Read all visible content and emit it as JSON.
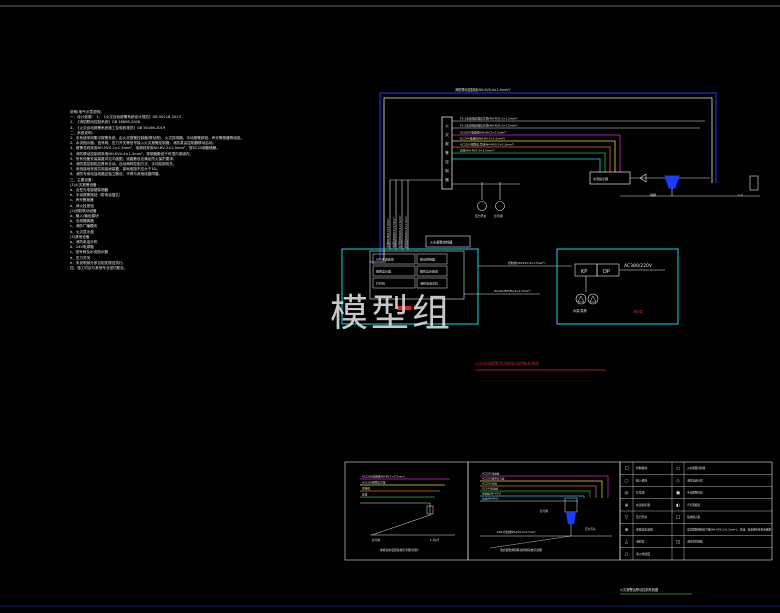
{
  "watermark": "模型组",
  "notes": [
    "说明(电气示意说明)",
    "一、设计依据：  1、《火灾自动报警系统设计规范》GB 50116-2013",
    "  2、《消防联动控制系统》GB 16806-2006",
    "  3、《火灾自动报警系统施工及验收规范》GB 50166-2019",
    "二、系统说明：",
    "1、本系统采用集中报警系统，由火灾报警控制器(联动型)、火灾探测器、手动报警按钮、声光警报器等组成。",
    "2、水流指示器、信号阀、压力开关等信号接入火灾报警控制器，消防泵由控制器联动启动。",
    "3、报警总线采用NH-RVS-2×1.5mm²，电源线采用NH-BV-2×2.5mm²，穿SC20钢管暗敷。",
    "4、消防联动控制线采用NH-KVV-4×1.5mm²，穿钢管敷设于吊顶内或墙内。",
    "5、所有设备安装高度详见平面图，线路敷设应满足防火保护要求。",
    "6、消防泵控制柜应具有手动、自动两种控制方式，手动控制优先。",
    "7、系统接地采用共用接地装置，接地电阻不应大于1Ω。",
    "8、消防专用电话线路应独立敷设，不得与其他线路同管。",
    "三、主要设备：",
    "(1)火灾报警设备",
    "  a、点型光电感烟探测器",
    "  b、手动报警按钮（带电话插孔）",
    "  c、声光警报器",
    "  d、消火栓按钮",
    "(2)消防联动设备",
    "  a、输入/输出模块",
    "  b、总线隔离器",
    "  c、消防广播模块",
    "  d、火灾显示盘",
    "(3)其他设备",
    "  a、消防电话分机",
    "  b、24V电源箱",
    "  c、信号阀及水流指示器",
    "  d、压力开关",
    "  e、未说明部分参见相关规范执行。",
    "四、施工时应与其他专业密切配合。"
  ],
  "main_diagram": {
    "top_bus_label": "消防联动控制线(NH-KVV-4×1.5mm²)",
    "panel_labels": [
      "火",
      "灾",
      "报",
      "警",
      "控",
      "制",
      "器"
    ],
    "signal_lines": [
      "FS-1水流指示器信号线(NH-RVS-2×1.5mm²)",
      "FS-2水流指示器信号线(NH-RVS-2×1.5mm²)",
      "AC220V电源线(NH-BV-2×2.5mm²)",
      "DC24V电源线(NH-BV-2×2.5mm²)",
      "AC220V报警信号线(NH-RVS-2×1.5mm²)",
      "总线(NH-RVS-2×1.5mm²)"
    ],
    "vertical_lines": [
      "总线NH-RVS-2×1.5mm²",
      "电源线NH-BV-2×2.5mm²",
      "信号线NH-RVS-2×1.5mm²",
      "控制线NH-KVV-4×1.5mm²"
    ],
    "middle_line_label": "信号线NH-RVS-2×1.5mm²",
    "controller_title": "火灾报警控制器",
    "controller_cells": [
      "UPS电源装置",
      "联动控制器",
      "报警显示器",
      "图形显示装置",
      "打印机",
      "消防电话总机"
    ],
    "link_label": "控制线(NH-KVV-4×1.5mm²)",
    "dp_label": "DC24V(NH-BV-2×2.5mm²)",
    "pump_box": {
      "kp": "KP",
      "dp": "DP",
      "voltage": "AC380/220V",
      "pump_label": "水泵/泵房"
    },
    "pump_red_label": "消防泵",
    "right_device_label": "水流指示器",
    "bottom_device_1": "压力开关",
    "bottom_device_2": "信号阀",
    "right_label_1": "闸阀",
    "right_label_2": "2.2",
    "caption": "火灾自动报警及消防联动控制系统图"
  },
  "small_diagram_left": {
    "lines": [
      "AC220V电源线(NH-BV-2×2.5mm²)",
      "AC220V报警信号线",
      "控制线",
      "总线"
    ],
    "labels": [
      "信号阀",
      "1-1信号"
    ],
    "caption": "末端试水装置系统示意图(局部)"
  },
  "small_diagram_right": {
    "lines": [
      "AC220V电源线",
      "AC220V报警信号线",
      "AC220V总线",
      "DC24V电源线",
      "控制线(NH-KVV)",
      "总线(NH-RVS)"
    ],
    "bottom_label": "ZD4-控制线NH-KVV-4×1.5mm²",
    "caption": "湿式报警阀组联动控制系统示意图",
    "mid_labels": [
      "信号阀",
      "压力开关"
    ]
  },
  "legend": {
    "rows": [
      {
        "symbol": "☐",
        "name": "控制模块",
        "sym2": "▭",
        "name2": "火灾报警控制器"
      },
      {
        "symbol": "○",
        "name": "输入模块",
        "sym2": "◇",
        "name2": "消防电话分机"
      },
      {
        "symbol": "◎",
        "name": "信号阀",
        "sym2": "▣",
        "name2": "手动报警按钮"
      },
      {
        "symbol": "⊕",
        "name": "水流指示器",
        "sym2": "◐",
        "name2": "声光警报器"
      },
      {
        "symbol": "▽",
        "name": "压力开关",
        "sym2": "□",
        "name2": "接线端子箱"
      },
      {
        "symbol": "⊗",
        "name": "末端试水装置",
        "sym2": "",
        "name2": "湿式报警阀组信号线(NH-RVS-2×1.5mm²)，总线，电源线等参见系统图"
      },
      {
        "symbol": "△",
        "name": "消防泵",
        "sym2": "◫",
        "name2": "消防泵控制箱"
      },
      {
        "symbol": "▯",
        "name": "消火栓按钮",
        "sym2": "",
        "name2": ""
      }
    ]
  },
  "footer_caption": "火灾报警及联动控制系统图",
  "colors": {
    "background": "#000000",
    "white_line": "#e8e8e8",
    "cyan": "#18d8e6",
    "red": "#e02020",
    "blue": "#1a3cff",
    "magenta": "#e020d0",
    "yellow": "#e8e030",
    "green": "#20c040",
    "orange": "#e87020",
    "frame_blue": "#1c2aa8"
  }
}
